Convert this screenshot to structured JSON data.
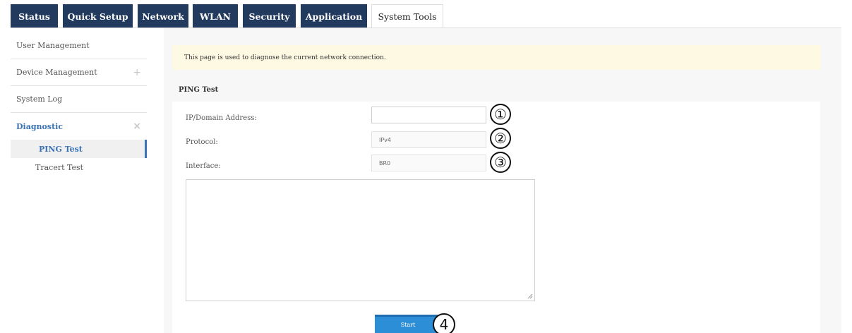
{
  "tabs": [
    {
      "label": "Status",
      "active": false
    },
    {
      "label": "Quick Setup",
      "active": false
    },
    {
      "label": "Network",
      "active": false
    },
    {
      "label": "WLAN",
      "active": false
    },
    {
      "label": "Security",
      "active": false
    },
    {
      "label": "Application",
      "active": false
    },
    {
      "label": "System Tools",
      "active": true
    }
  ],
  "sidebar": {
    "items": [
      {
        "label": "User Management",
        "expand": ""
      },
      {
        "label": "Device Management",
        "expand": "+"
      },
      {
        "label": "System Log",
        "expand": ""
      },
      {
        "label": "Diagnostic",
        "expand": "×"
      }
    ],
    "sub_items": [
      {
        "label": "PING Test",
        "active": true
      },
      {
        "label": "Tracert Test",
        "active": false
      }
    ]
  },
  "main": {
    "notice": "This page is used to diagnose the current network connection.",
    "section_title": "PING Test",
    "form": {
      "address_label": "IP/Domain Address:",
      "address_value": "",
      "protocol_label": "Protocol:",
      "protocol_value": "IPv4",
      "interface_label": "Interface:",
      "interface_value": "BR0"
    },
    "output_text": "",
    "start_label": "Start"
  },
  "callouts": [
    "①",
    "②",
    "③",
    "4"
  ],
  "colors": {
    "tab_bg": "#223a5e",
    "accent": "#3a73b5",
    "button": "#2c8ed6",
    "notice_bg": "#fdf9e3"
  }
}
